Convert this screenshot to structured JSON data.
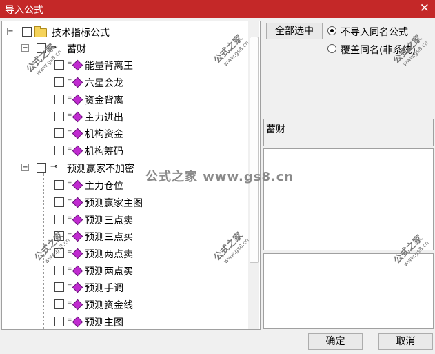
{
  "window": {
    "title": "导入公式"
  },
  "tree": {
    "root": {
      "label": "技术指标公式",
      "expander": "-"
    },
    "groups": [
      {
        "label": "蓄财",
        "expander": "-",
        "items": [
          "能量背离王",
          "六星会龙",
          "资金背离",
          "主力进出",
          "机构资金",
          "机构筹码"
        ]
      },
      {
        "label": "预测赢家不加密",
        "expander": "-",
        "items": [
          "主力仓位",
          "预测赢家主图",
          "预测三点卖",
          "预测三点买",
          "预测两点卖",
          "预测两点买",
          "预测手调",
          "预测资金线",
          "预测主图"
        ]
      }
    ]
  },
  "options": {
    "select_all_label": "全部选中",
    "radio_no_import": "不导入同名公式",
    "radio_overwrite": "覆盖同名(非系统)",
    "selected_radio": "no_import"
  },
  "info": {
    "name_text": "蓄财"
  },
  "footer": {
    "ok_label": "确定",
    "cancel_label": "取消"
  },
  "watermark": {
    "brand": "公式之家",
    "url": "www.gs8.cn",
    "center_text": "公式之家 www.gs8.cn"
  }
}
